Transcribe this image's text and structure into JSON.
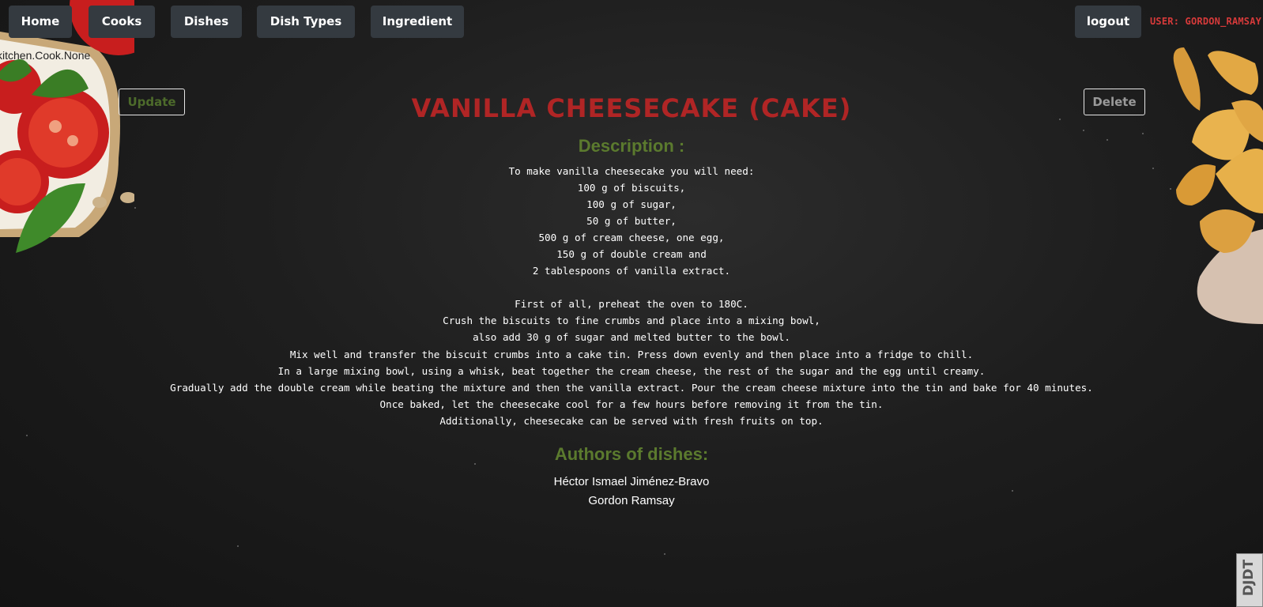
{
  "nav": {
    "items": [
      {
        "label": "Home"
      },
      {
        "label": "Cooks"
      },
      {
        "label": "Dishes"
      },
      {
        "label": "Dish Types"
      },
      {
        "label": "Ingredient"
      }
    ],
    "logout_label": "logout",
    "user_label": "USER: GORDON_RAMSAY"
  },
  "kitchen_cook_text": "kitchen.Cook.None",
  "actions": {
    "update_label": "Update",
    "delete_label": "Delete"
  },
  "dish": {
    "title": "VANILLA CHEESECAKE (CAKE)",
    "description_heading": "Description :",
    "description": "To make vanilla cheesecake you will need:\n100 g of biscuits,\n100 g of sugar,\n50 g of butter,\n500 g of cream cheese, one egg,\n150 g of double cream and\n2 tablespoons of vanilla extract.\n\nFirst of all, preheat the oven to 180C.\nCrush the biscuits to fine crumbs and place into a mixing bowl,\nalso add 30 g of sugar and melted butter to the bowl.\nMix well and transfer the biscuit crumbs into a cake tin. Press down evenly and then place into a fridge to chill.\nIn a large mixing bowl, using a whisk, beat together the cream cheese, the rest of the sugar and the egg until creamy.\nGradually add the double cream while beating the mixture and then the vanilla extract. Pour the cream cheese mixture into the tin and bake for 40 minutes.\nOnce baked, let the cheesecake cool for a few hours before removing it from the tin.\nAdditionally, cheesecake can be served with fresh fruits on top.",
    "authors_heading": "Authors of dishes:",
    "authors": [
      "Héctor Ismael Jiménez-Bravo",
      "Gordon Ramsay"
    ]
  },
  "debug_toolbar_label": "DJDT",
  "colors": {
    "background": "#1e1e1e",
    "nav_button": "#343a40",
    "title": "#b02525",
    "heading": "#5b7a2e",
    "user_label": "#d63a3a"
  }
}
